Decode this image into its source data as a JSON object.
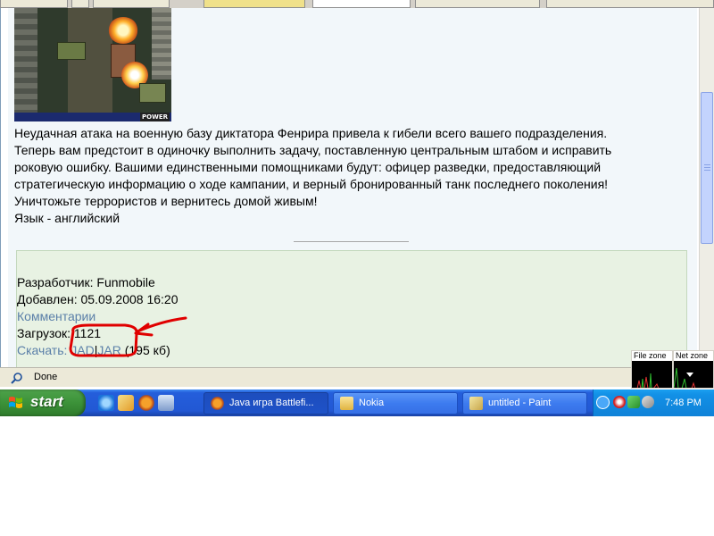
{
  "description": {
    "lines": [
      "Неудачная атака на военную базу диктатора Фенрира привела к гибели всего вашего подразделения.",
      "Теперь вам предстоит в одиночку выполнить задачу, поставленную центральным штабом и исправить",
      "роковую ошибку. Вашими единственными помощниками будут: офицер разведки, предоставляющий",
      "стратегическую информацию о ходе кампании, и верный бронированный танк последнего поколения!",
      "Уничтожьте террористов и вернитесь домой живым!",
      "Язык - английский"
    ]
  },
  "game_image": {
    "badge": "POWER"
  },
  "info": {
    "developer": "Разработчик: Funmobile",
    "added": "Добавлен: 05.09.2008 16:20",
    "comments_link": "Комментарии",
    "downloads": "Загрузок: 1121",
    "download_label": "Скачать:",
    "jad_link": "JAD",
    "separator": "|",
    "jar_link": "JAR",
    "size": "(195 кб)"
  },
  "statusbar": {
    "status": "Done",
    "file_zone": "File zone",
    "net_zone": "Net zone"
  },
  "taskbar": {
    "start_label": "start",
    "windows": [
      {
        "label": "Java игра Battlefi...",
        "icon": "firefox-icon"
      },
      {
        "label": "Nokia",
        "icon": "folder-icon"
      },
      {
        "label": "untitled - Paint",
        "icon": "paint-icon"
      }
    ],
    "clock": "7:48 PM"
  },
  "colors": {
    "link": "#5a7fa8",
    "info_background": "#e8f2e3",
    "annotation_red": "#e00000",
    "taskbar_blue": "#245edb"
  }
}
